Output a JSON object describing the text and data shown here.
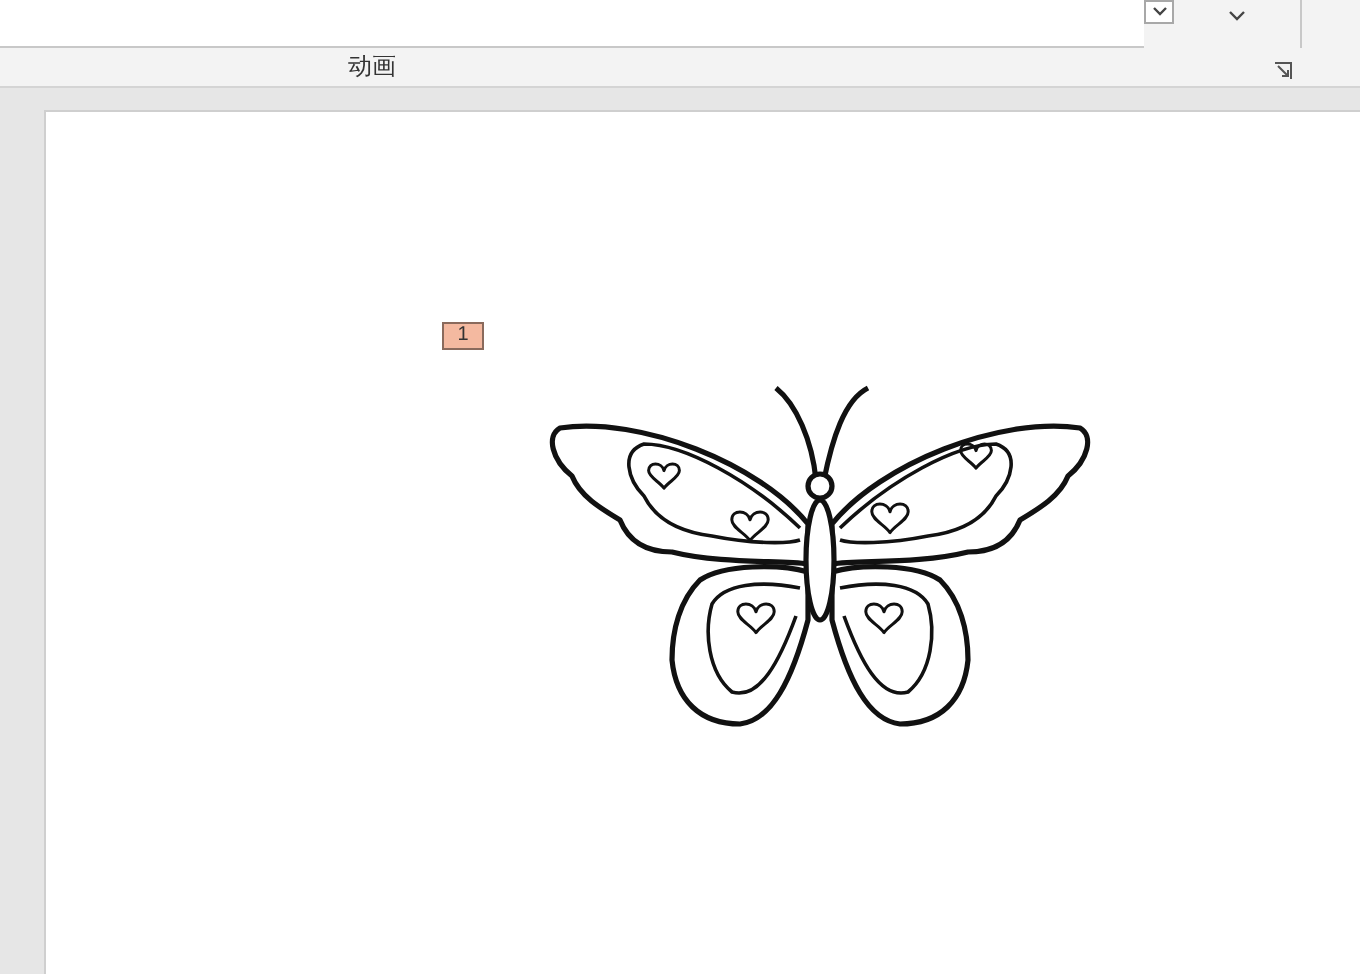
{
  "ribbon": {
    "group_label": "动画"
  },
  "slide": {
    "animation_tags": [
      {
        "label": "1"
      }
    ]
  }
}
